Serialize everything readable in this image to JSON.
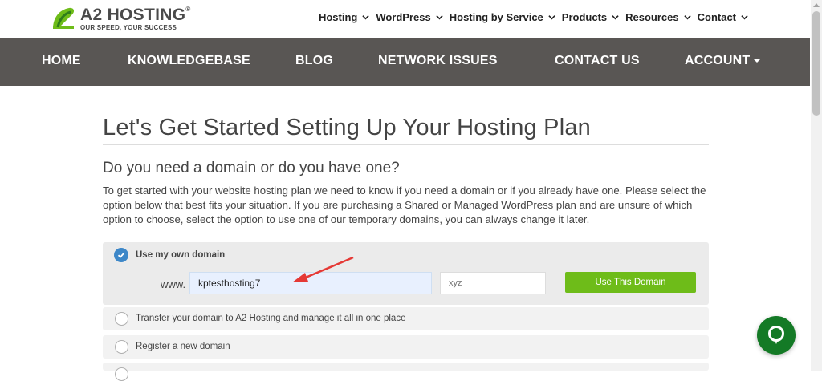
{
  "header": {
    "brand": "A2 HOSTING",
    "reg_mark": "®",
    "tagline": "OUR SPEED, YOUR SUCCESS",
    "top_nav": [
      "Hosting",
      "WordPress",
      "Hosting by Service",
      "Products",
      "Resources",
      "Contact"
    ]
  },
  "main_nav": {
    "home": "HOME",
    "knowledgebase": "KNOWLEDGEBASE",
    "blog": "BLOG",
    "network_issues": "NETWORK ISSUES",
    "contact_us": "CONTACT US",
    "account": "ACCOUNT"
  },
  "page": {
    "title": "Let's Get Started Setting Up Your Hosting Plan",
    "subtitle": "Do you need a domain or do you have one?",
    "description": "To get started with your website hosting plan we need to know if you need a domain or if you already have one. Please select the option below that best fits your situation. If you are purchasing a Shared or Managed WordPress plan and are unsure of which option to choose, select the option to use one of our temporary domains, you can always change it later."
  },
  "options": {
    "own_domain": {
      "label": "Use my own domain",
      "prefix": "www.",
      "domain_value": "kptesthosting7",
      "tld_placeholder": "xyz",
      "button": "Use This Domain",
      "checked": true
    },
    "transfer": {
      "label": "Transfer your domain to A2 Hosting and manage it all in one place"
    },
    "register": {
      "label": "Register a new domain"
    }
  },
  "colors": {
    "nav_bg": "#595654",
    "accent_green": "#6ebc19",
    "radio_blue": "#3d87c8",
    "chat_green": "#147a26",
    "annotation_red": "#e53935"
  },
  "icons": {
    "logo": "a2-logo-icon",
    "chevron": "chevron-down-icon",
    "check": "check-icon",
    "chat": "chat-bubble-icon",
    "arrow": "annotation-arrow-icon"
  }
}
